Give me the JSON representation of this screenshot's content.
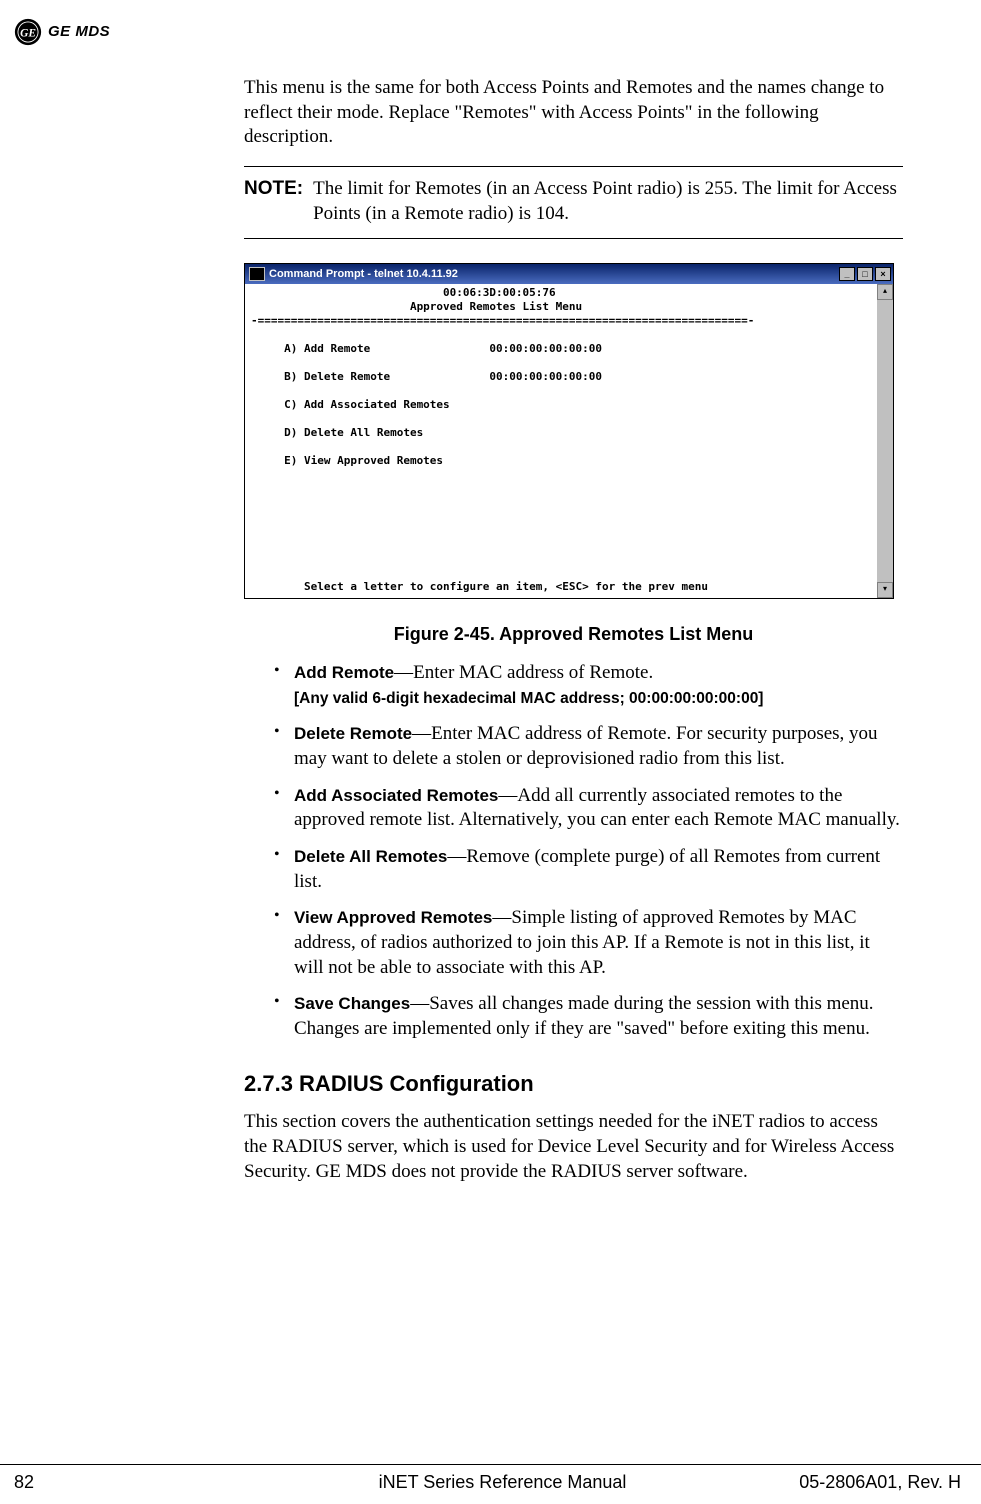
{
  "header": {
    "brand": "GE MDS"
  },
  "intro_para": "This menu is the same for both Access Points and Remotes and the names change to reflect their mode. Replace \"Remotes\" with Access Points\" in the following description.",
  "note": {
    "label": "NOTE:",
    "text": "The limit for Remotes (in an Access Point radio) is 255. The limit for Access Points (in a Remote radio) is 104."
  },
  "terminal": {
    "title": "Command Prompt - telnet 10.4.11.92",
    "body": "                             00:06:3D:00:05:76\n                        Approved Remotes List Menu\n-==========================================================================-\n\n     A) Add Remote                  00:00:00:00:00:00\n\n     B) Delete Remote               00:00:00:00:00:00\n\n     C) Add Associated Remotes\n\n     D) Delete All Remotes\n\n     E) View Approved Remotes\n\n\n\n\n\n\n\n\n        Select a letter to configure an item, <ESC> for the prev menu"
  },
  "figure_caption": "Figure 2-45. Approved Remotes List Menu",
  "bullets": [
    {
      "term": "Add Remote",
      "desc": "—Enter MAC address of Remote.",
      "sub": "[Any valid 6-digit hexadecimal MAC address; 00:00:00:00:00:00]"
    },
    {
      "term": "Delete Remote",
      "desc": "—Enter MAC address of Remote. For security purposes, you may want to delete a stolen or deprovisioned radio from this list."
    },
    {
      "term": "Add Associated Remotes",
      "desc": "—Add all currently associated remotes to the approved remote list. Alternatively, you can enter each Remote MAC manually."
    },
    {
      "term": "Delete All Remotes",
      "desc": "—Remove (complete purge) of all Remotes from current list."
    },
    {
      "term": "View Approved Remotes",
      "desc": "—Simple listing of approved Remotes by MAC address, of radios authorized to join this AP. If a Remote is not in this list, it will not be able to associate with this AP."
    },
    {
      "term": "Save Changes",
      "desc": "—Saves all changes made during the session with this menu. Changes are implemented only if they are \"saved\" before exiting this menu."
    }
  ],
  "section_heading": "2.7.3 RADIUS Configuration",
  "section_para": "This section covers the authentication settings needed for the iNET radios to access the RADIUS server, which is used for Device Level Security and for Wireless Access Security. GE MDS does not provide the RADIUS server software.",
  "footer": {
    "page_num": "82",
    "center": "iNET Series Reference Manual",
    "right": "05-2806A01, Rev. H"
  }
}
